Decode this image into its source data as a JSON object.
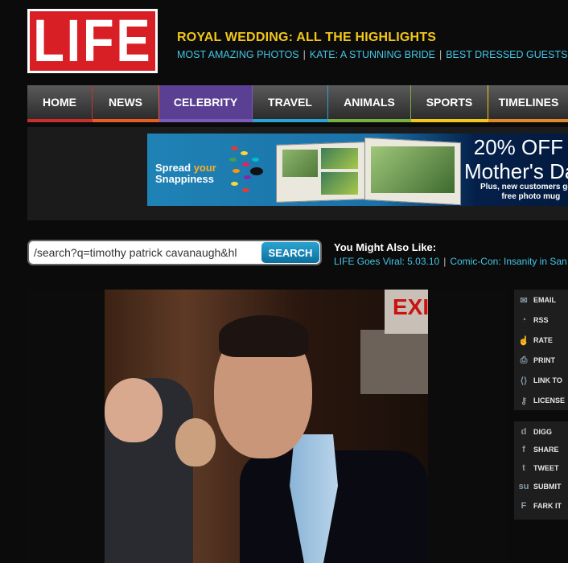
{
  "brand": {
    "logo_text": "LIFE",
    "logo_color": "#d91f26"
  },
  "header": {
    "headline": "ROYAL WEDDING: ALL THE HIGHLIGHTS",
    "sublinks": [
      "MOST AMAZING PHOTOS",
      "KATE: A STUNNING BRIDE",
      "BEST DRESSED GUESTS"
    ]
  },
  "nav": {
    "items": [
      {
        "label": "HOME",
        "accent": "#c9302c"
      },
      {
        "label": "NEWS",
        "accent": "#e85d23"
      },
      {
        "label": "CELEBRITY",
        "accent": "#5b3f93",
        "active": true
      },
      {
        "label": "TRAVEL",
        "accent": "#2aa3d1"
      },
      {
        "label": "ANIMALS",
        "accent": "#7ab03f"
      },
      {
        "label": "SPORTS",
        "accent": "#f3c61a"
      },
      {
        "label": "TIMELINES",
        "accent": "#e0892a"
      }
    ]
  },
  "ad": {
    "spread_line1": "Spread ",
    "spread_your": "your",
    "spread_line2": "Snappiness",
    "percent_off": "20% OFF",
    "mothers_day": "Mother's Da",
    "fine_print_1": "Plus, new customers get a",
    "fine_print_2": "free photo mug"
  },
  "search": {
    "query": "/search?q=timothy patrick cavanaugh&hl",
    "button_label": "SEARCH"
  },
  "also": {
    "title": "You Might Also Like:",
    "links": [
      "LIFE Goes Viral: 5.03.10",
      "Comic-Con: Insanity in San"
    ]
  },
  "photo": {
    "exit_sign": "EXIT"
  },
  "sidebar": {
    "group1": [
      {
        "label": "EMAIL",
        "icon": "envelope-icon",
        "glyph": "✉"
      },
      {
        "label": "RSS",
        "icon": "rss-icon",
        "glyph": "◔"
      },
      {
        "label": "RATE",
        "icon": "thumbs-up-icon",
        "glyph": "☝"
      },
      {
        "label": "PRINT",
        "icon": "printer-icon",
        "glyph": "⎙"
      },
      {
        "label": "LINK TO",
        "icon": "link-icon",
        "glyph": "⟨⟩"
      },
      {
        "label": "LICENSE",
        "icon": "license-icon",
        "glyph": "⚷"
      }
    ],
    "group2": [
      {
        "label": "DIGG",
        "icon": "digg-icon",
        "glyph": "d"
      },
      {
        "label": "SHARE",
        "icon": "facebook-icon",
        "glyph": "f"
      },
      {
        "label": "TWEET",
        "icon": "twitter-icon",
        "glyph": "t"
      },
      {
        "label": "SUBMIT",
        "icon": "stumbleupon-icon",
        "glyph": "su"
      },
      {
        "label": "FARK IT",
        "icon": "fark-icon",
        "glyph": "F"
      }
    ]
  }
}
